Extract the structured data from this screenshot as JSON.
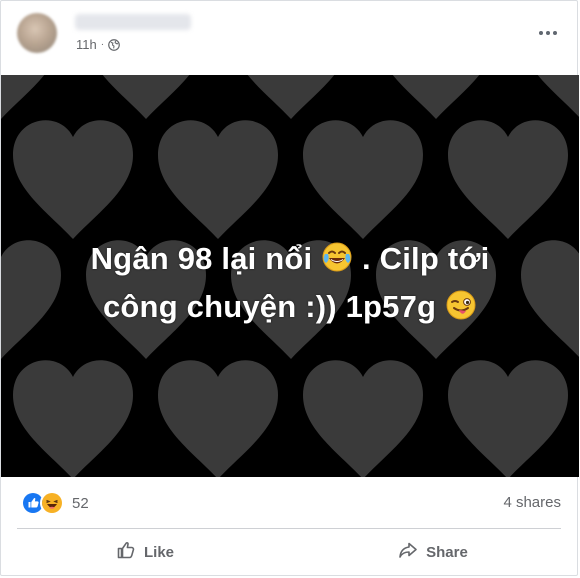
{
  "post": {
    "time": "11h",
    "separator": "·",
    "privacy_icon": "globe-icon",
    "more_icon": "more-options-icon"
  },
  "media": {
    "line1_text1": "Ngân 98 lại nổi",
    "line1_emoji": "face-with-tears-of-joy",
    "line1_text2": ". Cilp tới",
    "line2_text1": "công chuyện :)) 1p57g",
    "line2_emoji": "winking-face-with-tongue",
    "background_pattern": "dark-gray-hearts-on-black",
    "colors": {
      "background": "#000000",
      "heart": "#3a3a3a",
      "text": "#ffffff"
    }
  },
  "stats": {
    "reaction_icons": [
      "like-reaction-icon",
      "haha-reaction-icon"
    ],
    "reaction_count": "52",
    "shares": "4 shares"
  },
  "actions": {
    "like_label": "Like",
    "share_label": "Share"
  },
  "colors": {
    "accent_like": "#1877f2",
    "haha": "#f7b125",
    "muted_text": "#65676b"
  }
}
